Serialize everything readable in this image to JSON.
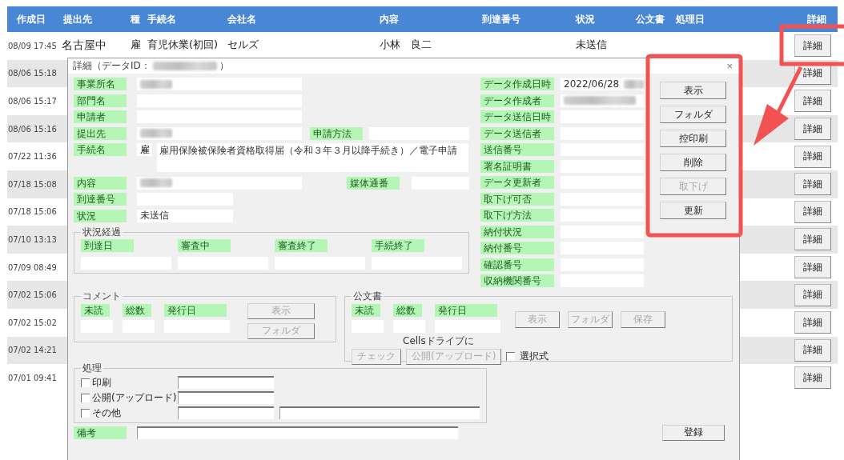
{
  "table": {
    "columns": [
      "作成日",
      "提出先",
      "種",
      "手続名",
      "会社名",
      "内容",
      "到達番号",
      "状況",
      "公文書",
      "処理日",
      "詳細"
    ],
    "rows": [
      {
        "created": "08/09 17:45",
        "submit_to": "名古屋中",
        "type_code": "雇",
        "procedure": "育児休業(初回)",
        "company": "セルズ",
        "content": "小林　良二",
        "status": "未送信",
        "button": "詳細"
      },
      {
        "created": "08/06 15:18",
        "button": "詳細"
      },
      {
        "created": "08/06 15:17",
        "button": "詳細"
      },
      {
        "created": "08/06 15:16",
        "button": "詳細"
      },
      {
        "created": "07/22 11:36",
        "button": "詳細"
      },
      {
        "created": "07/18 15:08",
        "button": "詳細"
      },
      {
        "created": "07/18 15:06",
        "button": "詳細"
      },
      {
        "created": "07/10 13:13",
        "button": "詳細"
      },
      {
        "created": "07/09 08:49",
        "button": "詳細"
      },
      {
        "created": "07/02 15:06",
        "button": "詳細"
      },
      {
        "created": "07/02 15:02",
        "button": "詳細"
      },
      {
        "created": "07/02 14:21",
        "button": "詳細"
      },
      {
        "created": "07/01 09:41",
        "button": "詳細"
      }
    ]
  },
  "dialog": {
    "title": "詳細（データID：",
    "title_end": "）",
    "id_redacted": true,
    "close": "×",
    "fields": [
      {
        "kind": "text",
        "label": "事業所名",
        "redacted": true
      },
      {
        "kind": "text",
        "label": "部門名"
      },
      {
        "kind": "text",
        "label": "申請者"
      },
      {
        "kind": "text",
        "label": "提出先",
        "redacted": true,
        "side_label": "申請方法"
      },
      {
        "kind": "procedure",
        "label": "手続名",
        "code": "雇",
        "value": "雇用保険被保険者資格取得届（令和３年３月以降手続き）／電子申請"
      },
      {
        "kind": "text",
        "label": "内容",
        "redacted": true,
        "side_label": "媒体通番"
      },
      {
        "kind": "short",
        "label": "到達番号"
      },
      {
        "kind": "short",
        "label": "状況",
        "value": "未送信"
      }
    ],
    "info_fields": [
      {
        "label": "データ作成日時",
        "value": "2022/06/28",
        "redacted": true
      },
      {
        "label": "データ作成者",
        "redacted": true
      },
      {
        "label": "データ送信日時"
      },
      {
        "label": "データ送信者"
      },
      {
        "label": "送信番号"
      },
      {
        "label": "署名証明書"
      },
      {
        "label": "データ更新者"
      },
      {
        "label": "取下げ可否"
      },
      {
        "label": "取下げ方法"
      },
      {
        "label": "納付状況"
      },
      {
        "label": "納付番号"
      },
      {
        "label": "確認番号"
      },
      {
        "label": "収納機関番号"
      }
    ],
    "actions": [
      {
        "label": "表示",
        "disabled": false
      },
      {
        "label": "フォルダ",
        "disabled": false
      },
      {
        "label": "控印刷",
        "disabled": false
      },
      {
        "label": "削除",
        "disabled": false
      },
      {
        "label": "取下げ",
        "disabled": true
      },
      {
        "label": "更新",
        "disabled": false
      }
    ],
    "progress": {
      "title": "状況経過",
      "steps": [
        "到達日",
        "審査中",
        "審査終了",
        "手続終了"
      ]
    },
    "comment": {
      "title": "コメント",
      "counts": [
        "未読",
        "総数",
        "発行日"
      ],
      "buttons": [
        {
          "label": "表示",
          "disabled": true
        },
        {
          "label": "フォルダ",
          "disabled": true
        }
      ]
    },
    "documents": {
      "title": "公文書",
      "counts": [
        "未読",
        "総数",
        "発行日"
      ],
      "buttons": [
        {
          "label": "表示",
          "disabled": true
        },
        {
          "label": "フォルダ",
          "disabled": true
        },
        {
          "label": "保存",
          "disabled": true
        }
      ],
      "cells_caption": "Cellsドライブに",
      "cells_buttons": [
        {
          "label": "チェック",
          "disabled": true
        },
        {
          "label": "公開(アップロード)",
          "disabled": true
        }
      ],
      "option": {
        "label": "選択式",
        "checked": false
      }
    },
    "processing": {
      "title": "処理",
      "options": [
        {
          "kind": "single",
          "label": "印刷",
          "checked": false
        },
        {
          "kind": "single",
          "label": "公開(アップロード)",
          "checked": false
        },
        {
          "kind": "double",
          "label": "その他",
          "checked": false
        }
      ]
    },
    "note": {
      "label": "備考"
    },
    "submit": {
      "label": "登録",
      "disabled": false
    }
  }
}
